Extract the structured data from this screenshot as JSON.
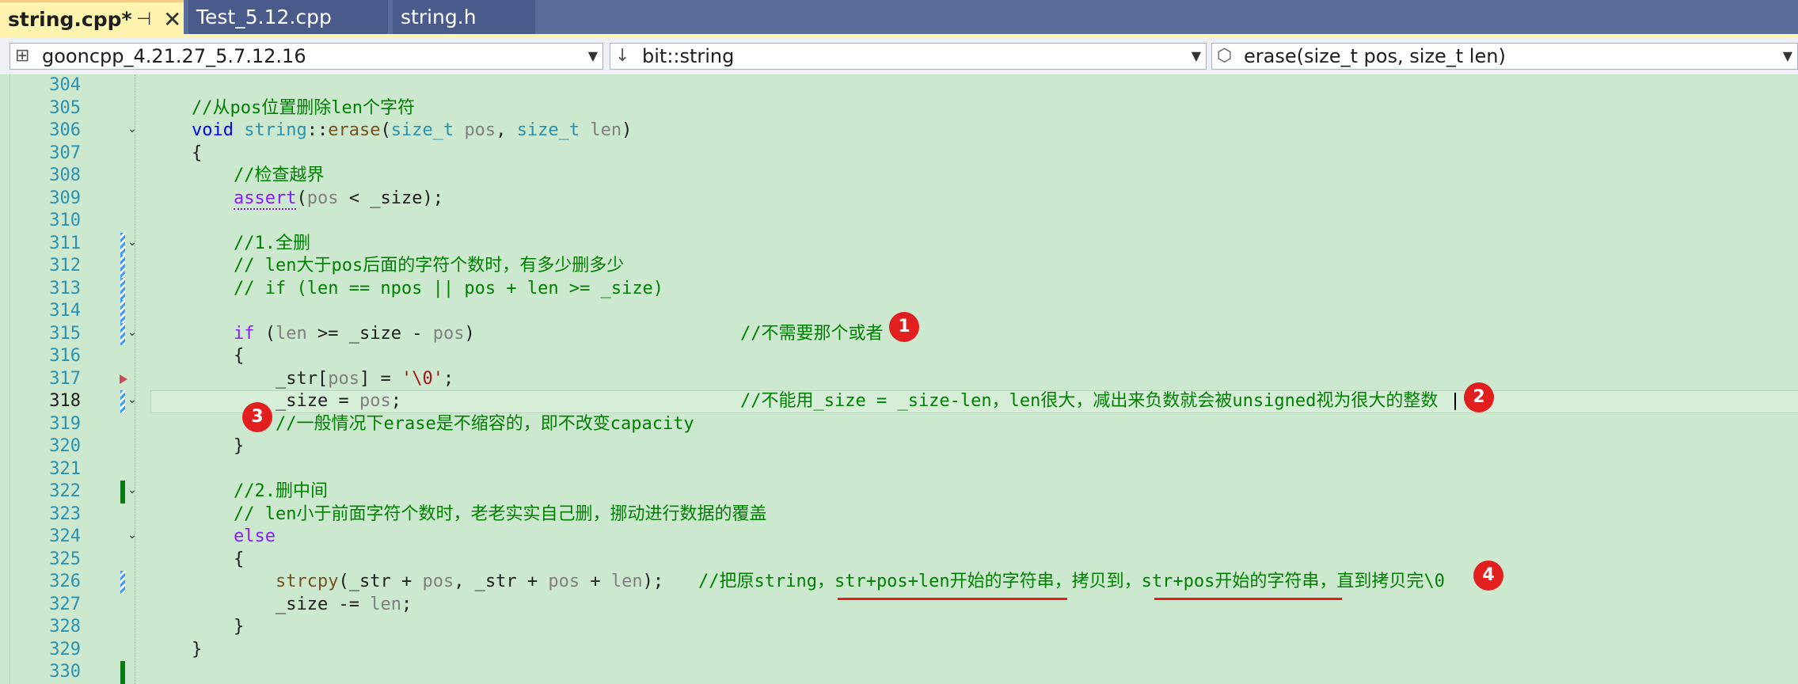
{
  "tabs": [
    {
      "label": "string.cpp*",
      "active": true,
      "pin_icon": "pin-icon",
      "close_icon": "close-icon"
    },
    {
      "label": "Test_5.12.cpp",
      "active": false
    },
    {
      "label": "string.h",
      "active": false
    }
  ],
  "nav": {
    "project": "gooncpp_4.21.27_5.7.12.16",
    "scope": "bit::string",
    "member": "erase(size_t pos, size_t len)"
  },
  "editor": {
    "current_line": "318",
    "lines": [
      {
        "n": "304"
      },
      {
        "n": "305"
      },
      {
        "n": "306"
      },
      {
        "n": "307"
      },
      {
        "n": "308"
      },
      {
        "n": "309"
      },
      {
        "n": "310"
      },
      {
        "n": "311"
      },
      {
        "n": "312"
      },
      {
        "n": "313"
      },
      {
        "n": "314"
      },
      {
        "n": "315"
      },
      {
        "n": "316"
      },
      {
        "n": "317"
      },
      {
        "n": "318"
      },
      {
        "n": "319"
      },
      {
        "n": "320"
      },
      {
        "n": "321"
      },
      {
        "n": "322"
      },
      {
        "n": "323"
      },
      {
        "n": "324"
      },
      {
        "n": "325"
      },
      {
        "n": "326"
      },
      {
        "n": "327"
      },
      {
        "n": "328"
      },
      {
        "n": "329"
      },
      {
        "n": "330"
      }
    ],
    "code": {
      "c305": "//从pos位置删除len个字符",
      "c306_void": "void",
      "c306_class": "string",
      "c306_sep": "::",
      "c306_fn": "erase",
      "c306_open": "(",
      "c306_t1": "size_t",
      "c306_p1": "pos",
      "c306_comma": ", ",
      "c306_t2": "size_t",
      "c306_p2": "len",
      "c306_close": ")",
      "c307": "{",
      "c308": "//检查越界",
      "c309_fn": "assert",
      "c309_open": "(",
      "c309_pos": "pos",
      "c309_rest": " < _size);",
      "c311": "//1.全删",
      "c312": "// len大于pos后面的字符个数时，有多少删多少",
      "c313": "// if (len == npos || pos + len >= _size)",
      "c315_if": "if",
      "c315_a": " (",
      "c315_len": "len",
      "c315_b": " >= _size - ",
      "c315_pos": "pos",
      "c315_c": ")",
      "c315_cmt": "//不需要那个或者",
      "c316": "{",
      "c317_a": "_str[",
      "c317_pos": "pos",
      "c317_b": "] = ",
      "c317_str": "'\\0'",
      "c317_c": ";",
      "c318_a": "_size = ",
      "c318_pos": "pos",
      "c318_b": ";",
      "c318_cmt": "//不能用_size = _size-len，len很大，减出来负数就会被unsigned视为很大的整数",
      "c319_cmt": "//一般情况下erase是不缩容的，即不改变capacity",
      "c320": "}",
      "c322": "//2.删中间",
      "c323": "// len小于前面字符个数时，老老实实自己删，挪动进行数据的覆盖",
      "c324": "else",
      "c325": "{",
      "c326_fn": "strcpy",
      "c326_a": "(_str + ",
      "c326_pos1": "pos",
      "c326_b": ", _str + ",
      "c326_pos2": "pos",
      "c326_c": " + ",
      "c326_len": "len",
      "c326_d": ");",
      "c326_cmt": "//把原string，str+pos+len开始的字符串，拷贝到，str+pos开始的字符串，直到拷贝完\\0",
      "c327_a": "_size -= ",
      "c327_len": "len",
      "c327_b": ";",
      "c328": "}",
      "c329": "}"
    }
  },
  "annotations": {
    "b1": "1",
    "b2": "2",
    "b3": "3",
    "b4": "4",
    "color": "#e21f1f"
  },
  "colors": {
    "editor_bg": "#cce8cf",
    "tabbar_bg": "#5b6b9a",
    "active_tab_bg": "#fff3b0",
    "line_number": "#2b91af",
    "comment": "#008000",
    "keyword": "#0000ff"
  }
}
